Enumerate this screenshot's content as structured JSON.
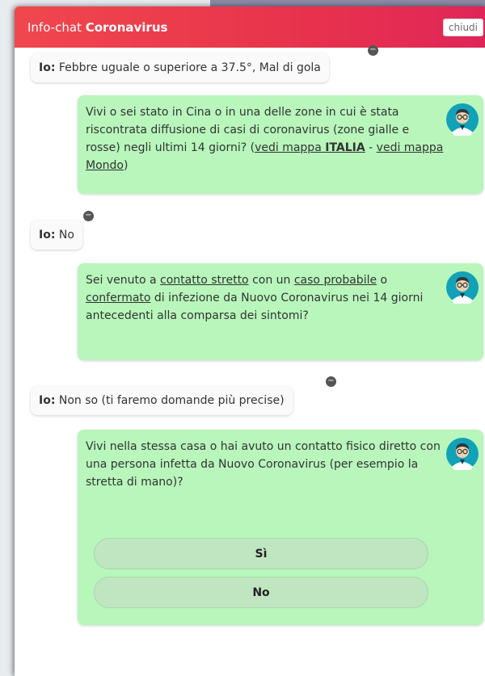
{
  "header": {
    "title_prefix": "Info-chat ",
    "title_bold": "Coronavirus",
    "close_label": "chiudi"
  },
  "user_label": "Io:",
  "messages": {
    "m1": " Febbre uguale o superiore a 37.5°, Mal di gola",
    "b1_a": "Vivi o sei stato in Cina o in una delle zone in cui è stata riscontrata diffusione di casi di coronavirus (zone gialle e rosse) negli ultimi 14 giorni? (",
    "b1_link1a": "vedi mappa ",
    "b1_link1b": "ITALIA",
    "b1_sep": " - ",
    "b1_link2": "vedi mappa Mondo",
    "b1_end": ")",
    "m2": " No",
    "b2_a": "Sei venuto a ",
    "b2_link1": "contatto stretto",
    "b2_b": " con un ",
    "b2_link2": "caso probabile",
    "b2_c": " o ",
    "b2_link3": "confermato",
    "b2_d": " di infezione da Nuovo Coronavirus nei 14 giorni antecedenti alla comparsa dei sintomi?",
    "m3": " Non so (ti faremo domande più precise)",
    "b3": "Vivi nella stessa casa o hai avuto un contatto fisico diretto con una persona infetta da Nuovo Coronavirus (per esempio la stretta di mano)?"
  },
  "choices": {
    "yes": "Sì",
    "no": "No"
  },
  "icons": {
    "remove": "minus-icon",
    "bot": "doctor-avatar-icon"
  },
  "colors": {
    "header_start": "#f0474d",
    "header_end": "#e02658",
    "bot_bubble": "#b8f6bb",
    "choice_button": "#bfe6c1"
  }
}
